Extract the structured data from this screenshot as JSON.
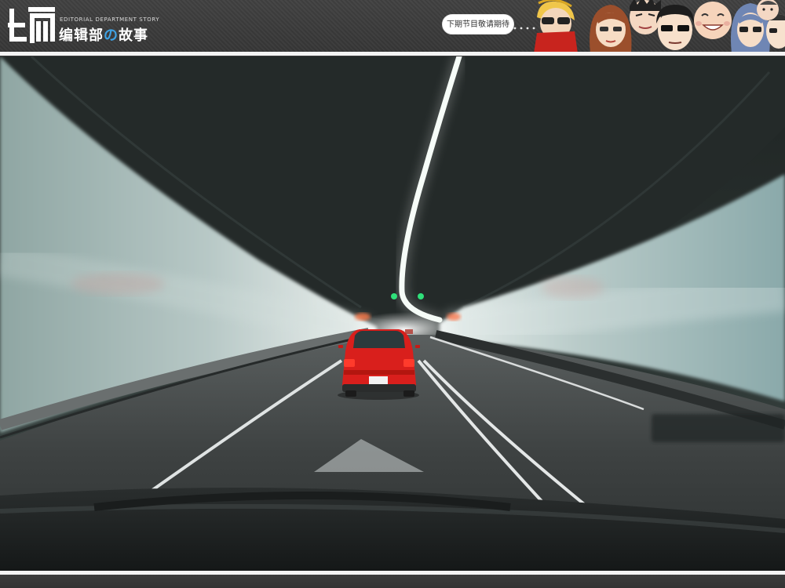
{
  "header": {
    "logo_char": "编",
    "tagline_en": "EDITORIAL DEPARTMENT STORY",
    "title_part1": "编辑部",
    "title_part2": "の",
    "title_part3": "故事",
    "bubble_text": "下期节目敬请期待",
    "faces": [
      "face-blonde-sunglasses-icon",
      "face-brown-hair-glasses-icon",
      "face-spiky-hair-icon",
      "face-black-hair-glasses-icon",
      "face-bald-smiling-icon",
      "face-blue-hair-glasses-icon",
      "face-partial-icon"
    ]
  },
  "photo": {
    "subject": "tunnel-road-with-red-car",
    "license_plate": "",
    "colors": {
      "car": "#d91f1c",
      "ceiling_light": "#f4fbf6",
      "tunnel_wall": "#9fb6b4",
      "road": "#3d3f40"
    }
  }
}
